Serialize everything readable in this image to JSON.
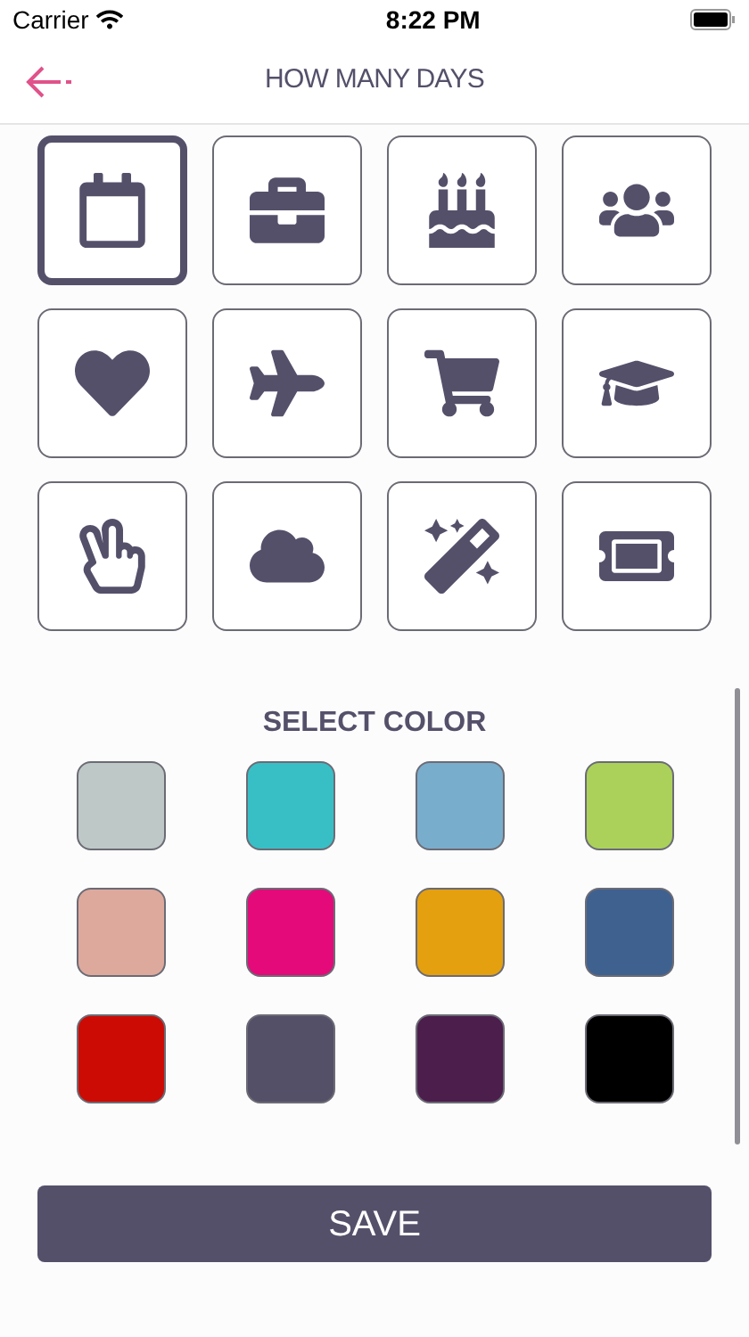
{
  "status_bar": {
    "carrier": "Carrier",
    "time": "8:22 PM"
  },
  "nav": {
    "title": "HOW MANY DAYS"
  },
  "icons": [
    {
      "selected": true
    },
    {
      "selected": false
    },
    {
      "selected": false
    },
    {
      "selected": false
    },
    {
      "selected": false
    },
    {
      "selected": false
    },
    {
      "selected": false
    },
    {
      "selected": false
    },
    {
      "selected": false
    },
    {
      "selected": false
    },
    {
      "selected": false
    },
    {
      "selected": false
    }
  ],
  "color_section": {
    "title": "SELECT COLOR"
  },
  "colors": [
    {
      "color": "#bec8c6"
    },
    {
      "color": "#38bfc6"
    },
    {
      "color": "#79adcc"
    },
    {
      "color": "#abd15a"
    },
    {
      "color": "#dda99d"
    },
    {
      "color": "#e40a7a"
    },
    {
      "color": "#e4a00e"
    },
    {
      "color": "#3f6190"
    },
    {
      "color": "#cc0b05"
    },
    {
      "color": "#545068"
    },
    {
      "color": "#4b1e4c"
    },
    {
      "color": "#000000"
    }
  ],
  "save_button": {
    "label": "SAVE"
  }
}
